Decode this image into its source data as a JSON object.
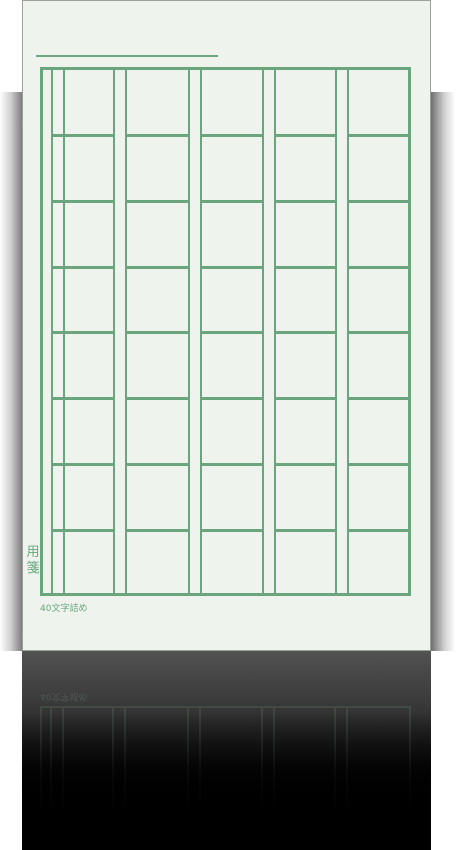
{
  "sheet": {
    "side_label": "用箋",
    "footer_note": "40文字詰め"
  },
  "grid": {
    "columns": 5,
    "rows": 8
  },
  "colors": {
    "paper": "#eef3ee",
    "rule": "#6aa57e",
    "reflection_top": "#525252",
    "reflection_bottom": "#000000"
  }
}
